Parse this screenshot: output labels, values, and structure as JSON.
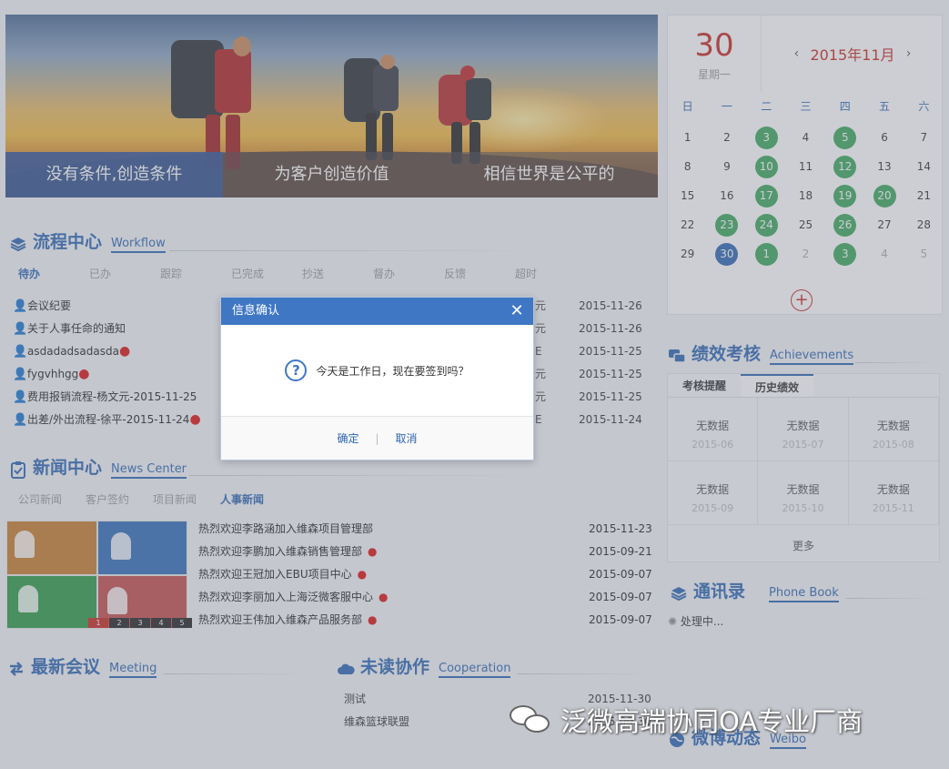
{
  "banner": {
    "tabs": [
      "没有条件,创造条件",
      "为客户创造价值",
      "相信世界是公平的"
    ]
  },
  "workflow": {
    "title_cn": "流程中心",
    "title_en": "Workflow",
    "tabs": [
      "待办",
      "已办",
      "跟踪",
      "已完成",
      "抄送",
      "督办",
      "反馈",
      "超时"
    ],
    "rows": [
      {
        "title": "会议纪要",
        "extra": "元",
        "date": "2015-11-26"
      },
      {
        "title": "关于人事任命的通知",
        "extra": "元",
        "date": "2015-11-26"
      },
      {
        "title": "asdadadsadasda",
        "extra": "E",
        "date": "2015-11-25"
      },
      {
        "title": "fygvhhgg",
        "extra": "元",
        "date": "2015-11-25"
      },
      {
        "title": "费用报销流程-杨文元-2015-11-25",
        "extra": "元",
        "date": "2015-11-25"
      },
      {
        "title": "出差/外出流程-徐平-2015-11-24",
        "extra": "E",
        "date": "2015-11-24"
      }
    ]
  },
  "news": {
    "title_cn": "新闻中心",
    "title_en": "News Center",
    "tabs": [
      "公司新闻",
      "客户签约",
      "项目新闻",
      "人事新闻"
    ],
    "pager": [
      "1",
      "2",
      "3",
      "4",
      "5"
    ],
    "rows": [
      {
        "title": "热烈欢迎李路涵加入维森项目管理部",
        "date": "2015-11-23"
      },
      {
        "title": "热烈欢迎李鹏加入维森销售管理部",
        "date": "2015-09-21"
      },
      {
        "title": "热烈欢迎王冠加入EBU项目中心",
        "date": "2015-09-07"
      },
      {
        "title": "热烈欢迎李丽加入上海泛微客服中心",
        "date": "2015-09-07"
      },
      {
        "title": "热烈欢迎王伟加入维森产品服务部",
        "date": "2015-09-07"
      }
    ]
  },
  "meeting": {
    "title_cn": "最新会议",
    "title_en": "Meeting"
  },
  "cooperation": {
    "title_cn": "未读协作",
    "title_en": "Cooperation",
    "rows": [
      {
        "title": "测试",
        "date": "2015-11-30"
      },
      {
        "title": "维森篮球联盟",
        "date": "2015-09-30"
      }
    ]
  },
  "calendar": {
    "day": "30",
    "weekday": "星期一",
    "month": "2015年11月",
    "prev": "‹",
    "next": "›",
    "headers": [
      "日",
      "一",
      "二",
      "三",
      "四",
      "五",
      "六"
    ],
    "weeks": [
      [
        "1",
        "2",
        "3",
        "4",
        "5",
        "6",
        "7"
      ],
      [
        "8",
        "9",
        "10",
        "11",
        "12",
        "13",
        "14"
      ],
      [
        "15",
        "16",
        "17",
        "18",
        "19",
        "20",
        "21"
      ],
      [
        "22",
        "23",
        "24",
        "25",
        "26",
        "27",
        "28"
      ],
      [
        "29",
        "30",
        "1",
        "2",
        "3",
        "4",
        "5"
      ]
    ],
    "work_days": [
      "3",
      "5",
      "10",
      "12",
      "17",
      "19",
      "20",
      "23",
      "24",
      "26"
    ],
    "next_month_work_days": [
      "1",
      "3"
    ],
    "today": "30",
    "add_symbol": "+",
    "colors": {
      "work": "#3ba65b",
      "today": "#2d66b3"
    }
  },
  "achievements": {
    "title_cn": "绩效考核",
    "title_en": "Achievements",
    "tabs": [
      "考核提醒",
      "历史绩效"
    ],
    "cells": [
      {
        "label": "无数据",
        "month": "2015-06"
      },
      {
        "label": "无数据",
        "month": "2015-07"
      },
      {
        "label": "无数据",
        "month": "2015-08"
      },
      {
        "label": "无数据",
        "month": "2015-09"
      },
      {
        "label": "无数据",
        "month": "2015-10"
      },
      {
        "label": "无数据",
        "month": "2015-11"
      }
    ],
    "more": "更多"
  },
  "phonebook": {
    "title_cn": "通讯录",
    "title_en": "Phone Book",
    "status": "处理中..."
  },
  "weibo": {
    "title_cn": "微博动态",
    "title_en": "Weibo"
  },
  "dialog": {
    "title": "信息确认",
    "close": "✕",
    "message": "今天是工作日，现在要签到吗？",
    "icon": "?",
    "ok": "确定",
    "separator": "|",
    "cancel": "取消"
  },
  "watermark": {
    "text": "泛微高端协同OA专业厂商"
  },
  "colors": {
    "accent": "#2d66b3",
    "dialog_header": "#3f77c4",
    "red": "#c9271f"
  }
}
